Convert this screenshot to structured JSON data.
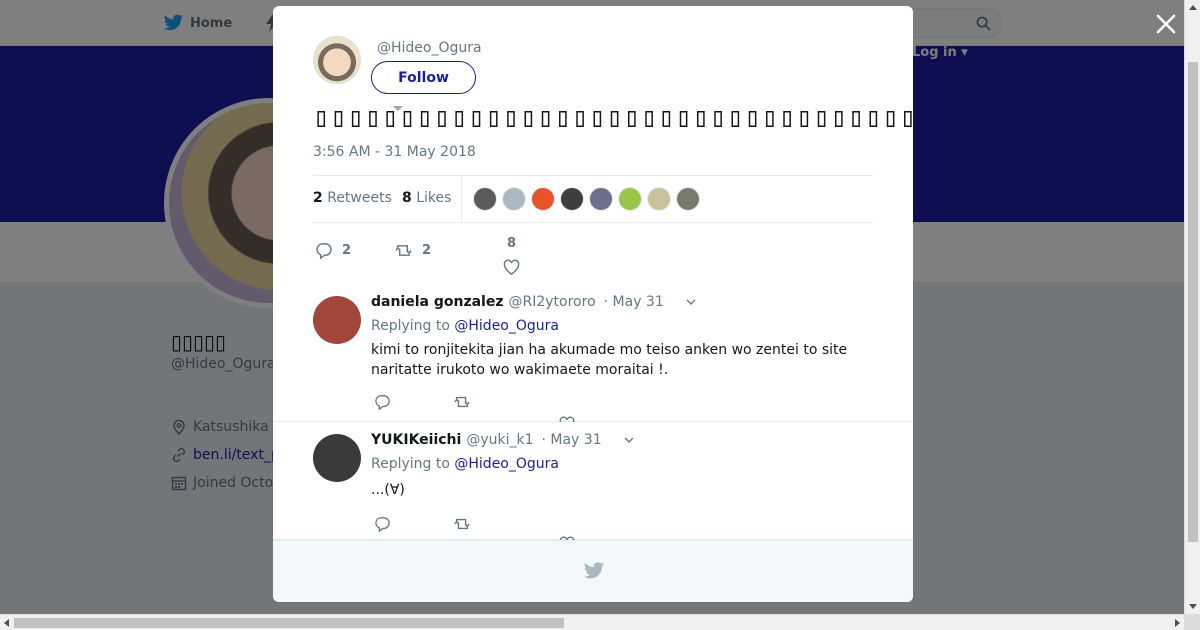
{
  "nav": {
    "home_label": "Home",
    "login_label": "Log in ▾"
  },
  "profile": {
    "name": "▯▯▯▯▯",
    "handle": "@Hideo_Ogura",
    "location": "Katsushika Tokyo",
    "link": "ben.li/text_p",
    "joined": "Joined Octo"
  },
  "modal": {
    "handle": "@Hideo_Ogura",
    "follow_label": "Follow",
    "tweet_text": "▯▯▯▯▯▯▯▯▯▯▯▯▯▯▯▯▯▯▯▯▯▯▯▯▯▯▯▯▯▯▯▯▯▯▯▯▯▯▯▯▯▯▯▯▯▯▯▯▯▯▯",
    "timestamp": "3:56 AM - 31 May 2018",
    "retweets_count": "2",
    "retweets_label": "Retweets",
    "likes_count": "8",
    "likes_label": "Likes",
    "liker_colors": [
      "#5b5b5b",
      "#aab8c2",
      "#e8542a",
      "#3d3d3d",
      "#6b6f8a",
      "#9bc44a",
      "#c9c19a",
      "#7b7a6a"
    ],
    "reply_count": "2",
    "retweet_count": "2",
    "like_count": "8"
  },
  "replies": [
    {
      "name": "daniela gonzalez",
      "handle": "@RI2ytororo",
      "date": "· May 31",
      "replying_prefix": "Replying to",
      "replying_to": "@Hideo_Ogura",
      "text": "kimi to ronjitekita jian ha akumade mo teiso anken wo zentei to site naritatte irukoto wo wakimaete moraitai !.",
      "avatar_color": "#a0463a"
    },
    {
      "name": "YUKIKeiichi",
      "handle": "@yuki_k1",
      "date": "· May 31",
      "replying_prefix": "Replying to",
      "replying_to": "@Hideo_Ogura",
      "text": "...(∀)",
      "avatar_color": "#3a3a3a"
    }
  ],
  "colors": {
    "brand": "#1b1ea1",
    "muted": "#657786"
  }
}
